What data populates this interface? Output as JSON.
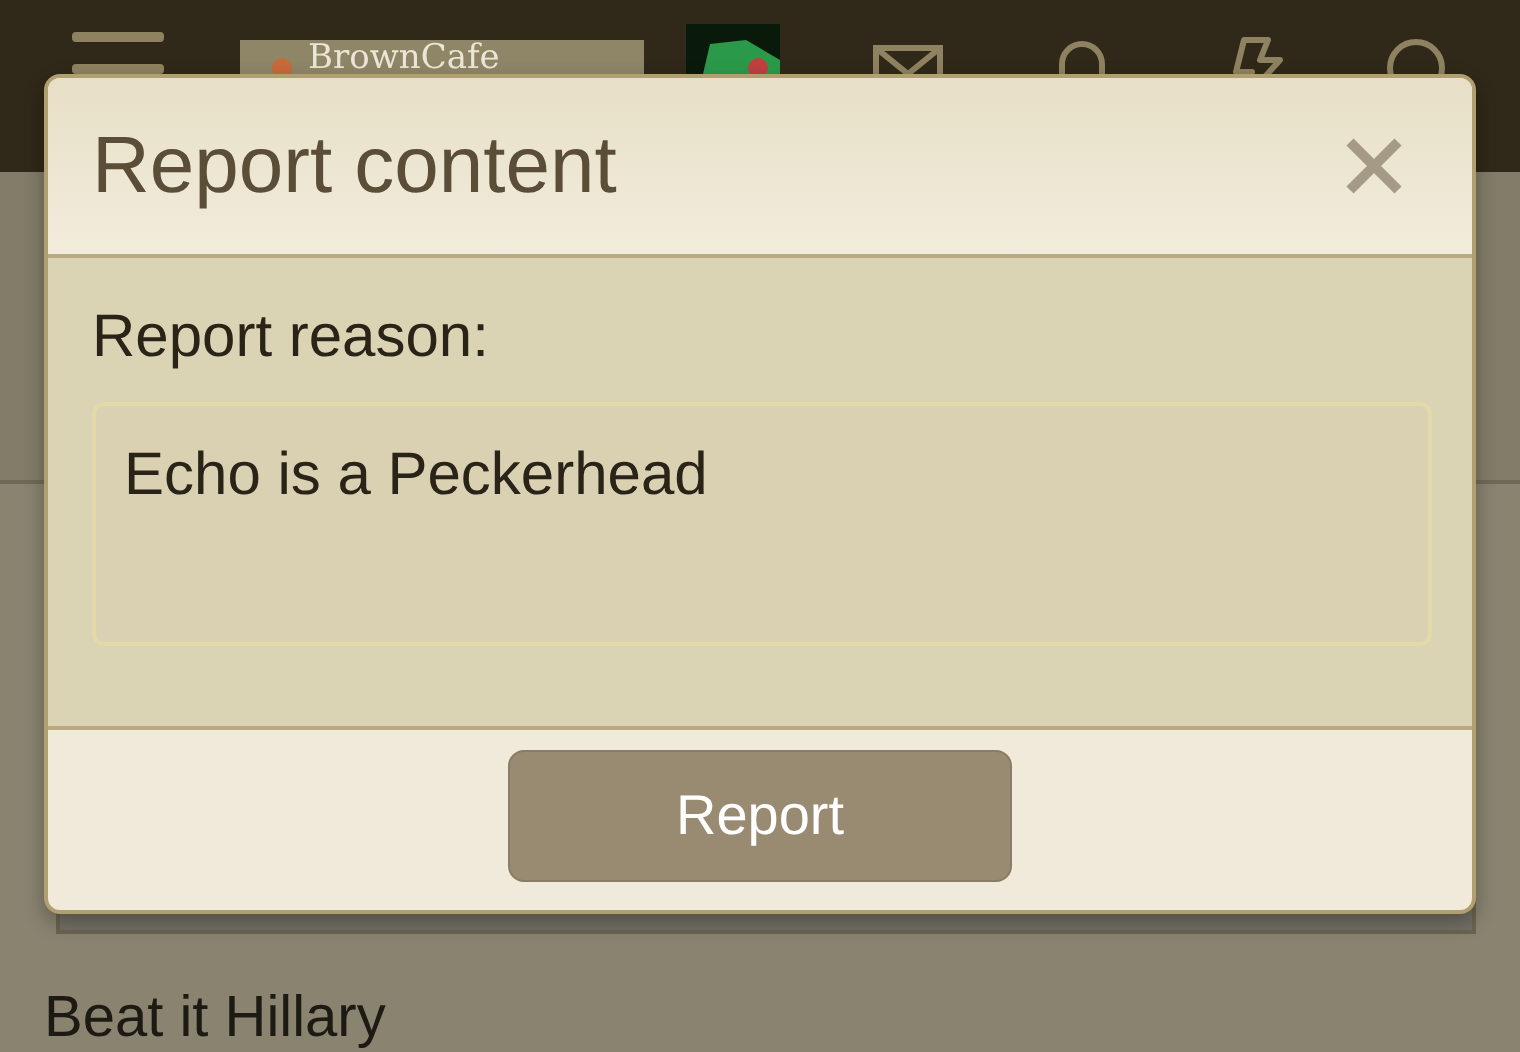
{
  "header": {
    "logo": "BrownCafe"
  },
  "page": {
    "post_title": "Beat it Hillary"
  },
  "dialog": {
    "title": "Report content",
    "label": "Report reason:",
    "reason": {
      "value": "Echo is a Peckerhead"
    },
    "button": "Report"
  }
}
